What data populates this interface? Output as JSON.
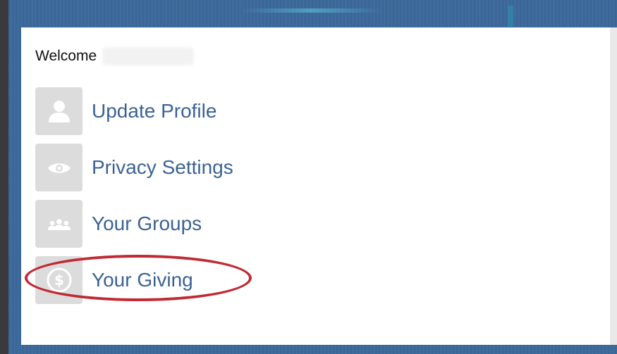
{
  "welcome": {
    "label": "Welcome"
  },
  "menu": [
    {
      "label": "Update Profile",
      "icon": "person-icon"
    },
    {
      "label": "Privacy Settings",
      "icon": "eye-icon"
    },
    {
      "label": "Your Groups",
      "icon": "group-icon"
    },
    {
      "label": "Your Giving",
      "icon": "dollar-coin-icon"
    }
  ],
  "colors": {
    "link": "#3b6294",
    "icon_bg": "#dcdcdc",
    "highlight": "#c02a34",
    "frame": "#3c6899"
  }
}
